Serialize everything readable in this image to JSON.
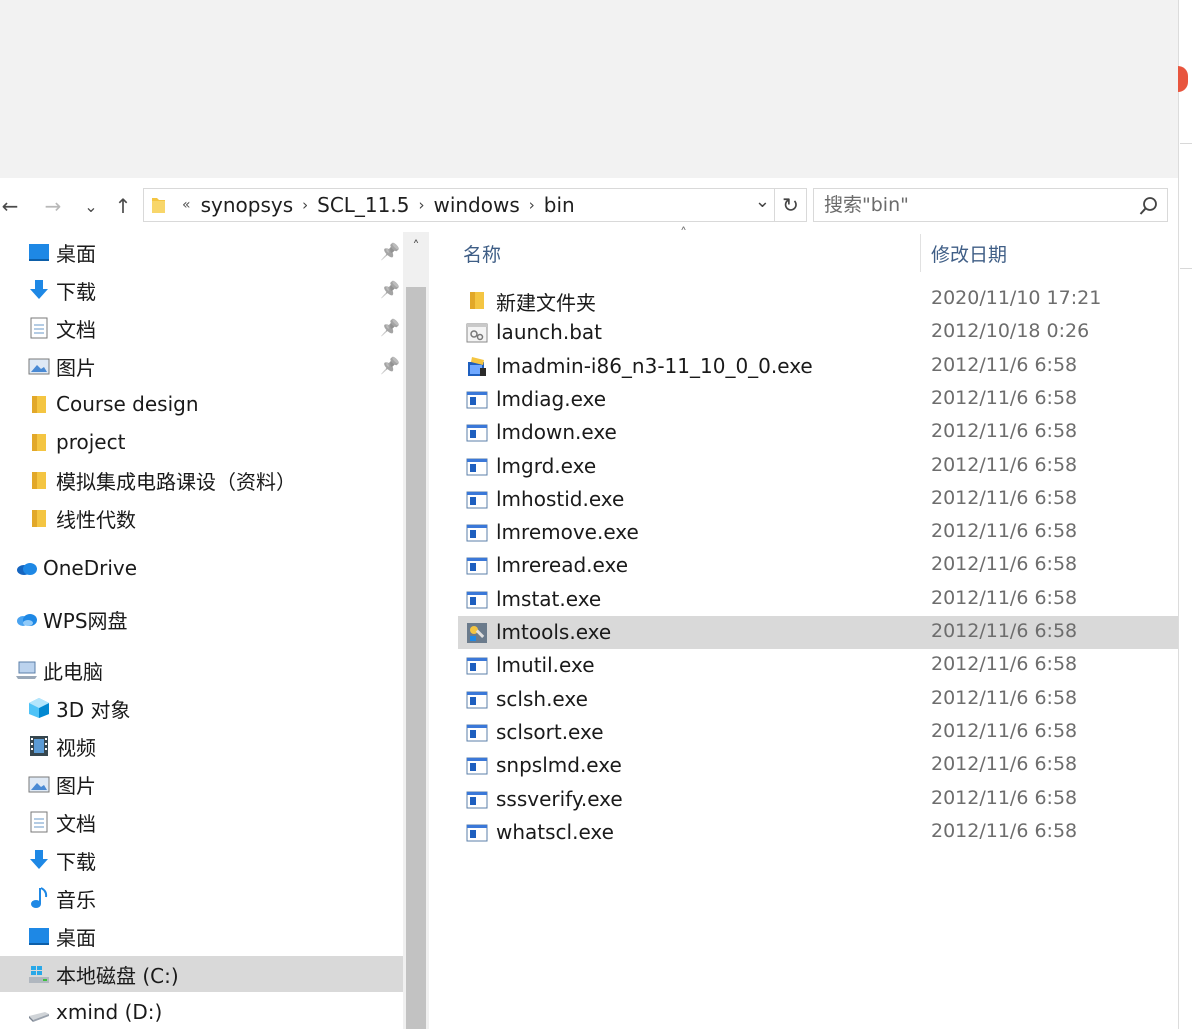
{
  "toolbar": {
    "back": "←",
    "forward": "→",
    "recent": "⌄",
    "up": "↑",
    "breadcrumb_overflow": "«",
    "breadcrumb": [
      "synopsys",
      "SCL_11.5",
      "windows",
      "bin"
    ],
    "breadcrumb_sep": "›",
    "dropdown": "⌄",
    "refresh": "↻",
    "search_placeholder": "搜索\"bin\"",
    "search_icon": "search-icon"
  },
  "nav_pane": {
    "quick_access": [
      {
        "label": "桌面",
        "icon": "desktop-icon",
        "pinned": true
      },
      {
        "label": "下载",
        "icon": "download-icon",
        "pinned": true
      },
      {
        "label": "文档",
        "icon": "document-icon",
        "pinned": true
      },
      {
        "label": "图片",
        "icon": "picture-icon",
        "pinned": true
      },
      {
        "label": "Course design",
        "icon": "folder-icon",
        "pinned": false
      },
      {
        "label": "project",
        "icon": "folder-icon",
        "pinned": false
      },
      {
        "label": "模拟集成电路课设（资料）",
        "icon": "folder-icon",
        "pinned": false
      },
      {
        "label": "线性代数",
        "icon": "folder-icon",
        "pinned": false
      }
    ],
    "onedrive": "OneDrive",
    "wps": "WPS网盘",
    "this_pc": "此电脑",
    "pc_items": [
      {
        "label": "3D 对象",
        "icon": "3d-objects-icon"
      },
      {
        "label": "视频",
        "icon": "video-icon"
      },
      {
        "label": "图片",
        "icon": "picture-icon"
      },
      {
        "label": "文档",
        "icon": "document-icon"
      },
      {
        "label": "下载",
        "icon": "download-icon"
      },
      {
        "label": "音乐",
        "icon": "music-icon"
      },
      {
        "label": "桌面",
        "icon": "desktop-icon"
      },
      {
        "label": "本地磁盘 (C:)",
        "icon": "windows-drive-icon",
        "selected": true
      },
      {
        "label": "xmind (D:)",
        "icon": "drive-icon"
      }
    ],
    "pin_glyph": "📌",
    "scroll_up": "˄"
  },
  "columns": {
    "name": "名称",
    "date": "修改日期",
    "sort_caret": "˄"
  },
  "files": [
    {
      "name": "新建文件夹",
      "date": "2020/11/10 17:21",
      "icon": "folder-icon"
    },
    {
      "name": "launch.bat",
      "date": "2012/10/18 0:26",
      "icon": "batch-file-icon"
    },
    {
      "name": "lmadmin-i86_n3-11_10_0_0.exe",
      "date": "2012/11/6 6:58",
      "icon": "installer-icon"
    },
    {
      "name": "lmdiag.exe",
      "date": "2012/11/6 6:58",
      "icon": "exe-icon"
    },
    {
      "name": "lmdown.exe",
      "date": "2012/11/6 6:58",
      "icon": "exe-icon"
    },
    {
      "name": "lmgrd.exe",
      "date": "2012/11/6 6:58",
      "icon": "exe-icon"
    },
    {
      "name": "lmhostid.exe",
      "date": "2012/11/6 6:58",
      "icon": "exe-icon"
    },
    {
      "name": "lmremove.exe",
      "date": "2012/11/6 6:58",
      "icon": "exe-icon"
    },
    {
      "name": "lmreread.exe",
      "date": "2012/11/6 6:58",
      "icon": "exe-icon"
    },
    {
      "name": "lmstat.exe",
      "date": "2012/11/6 6:58",
      "icon": "exe-icon"
    },
    {
      "name": "lmtools.exe",
      "date": "2012/11/6 6:58",
      "icon": "tools-icon",
      "selected": true
    },
    {
      "name": "lmutil.exe",
      "date": "2012/11/6 6:58",
      "icon": "exe-icon"
    },
    {
      "name": "sclsh.exe",
      "date": "2012/11/6 6:58",
      "icon": "exe-icon"
    },
    {
      "name": "sclsort.exe",
      "date": "2012/11/6 6:58",
      "icon": "exe-icon"
    },
    {
      "name": "snpslmd.exe",
      "date": "2012/11/6 6:58",
      "icon": "exe-icon"
    },
    {
      "name": "sssverify.exe",
      "date": "2012/11/6 6:58",
      "icon": "exe-icon"
    },
    {
      "name": "whatscl.exe",
      "date": "2012/11/6 6:58",
      "icon": "exe-icon"
    }
  ],
  "colors": {
    "selection": "#d9d9d9",
    "header_text": "#3f5e86",
    "folder": "#f4c542",
    "accent_blue": "#1e88e5"
  }
}
